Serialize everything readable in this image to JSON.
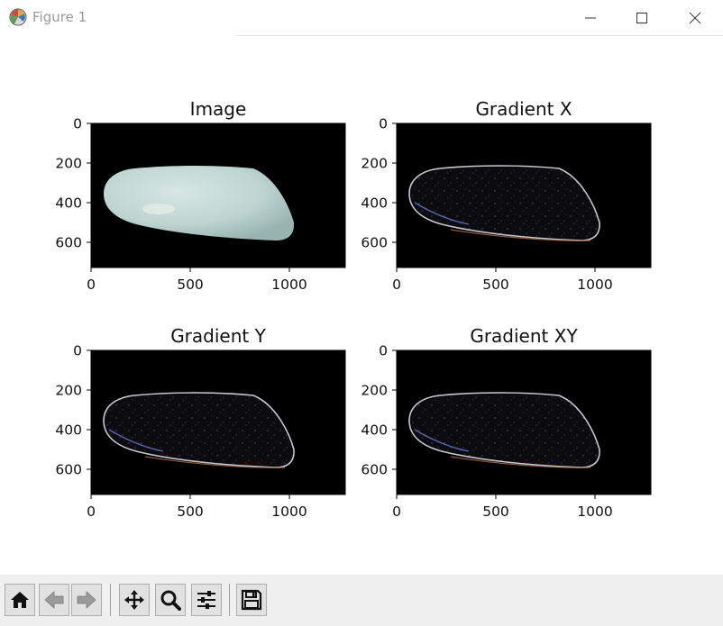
{
  "window": {
    "title": "Figure 1"
  },
  "plots": [
    {
      "title": "Image",
      "kind": "photo"
    },
    {
      "title": "Gradient X",
      "kind": "gradient"
    },
    {
      "title": "Gradient Y",
      "kind": "gradient"
    },
    {
      "title": "Gradient XY",
      "kind": "gradient"
    }
  ],
  "axes": {
    "xticks": [
      "0",
      "500",
      "1000"
    ],
    "yticks": [
      "0",
      "200",
      "400",
      "600"
    ]
  },
  "toolbar": {
    "buttons": [
      "home-icon",
      "back-arrow-icon",
      "forward-arrow-icon",
      "pan-icon",
      "zoom-icon",
      "configure-subplots-icon",
      "save-icon"
    ]
  },
  "colors": {
    "toolbar_bg": "#f0f0f0",
    "image_bg": "#000000",
    "stone": "#c9dcd8"
  }
}
